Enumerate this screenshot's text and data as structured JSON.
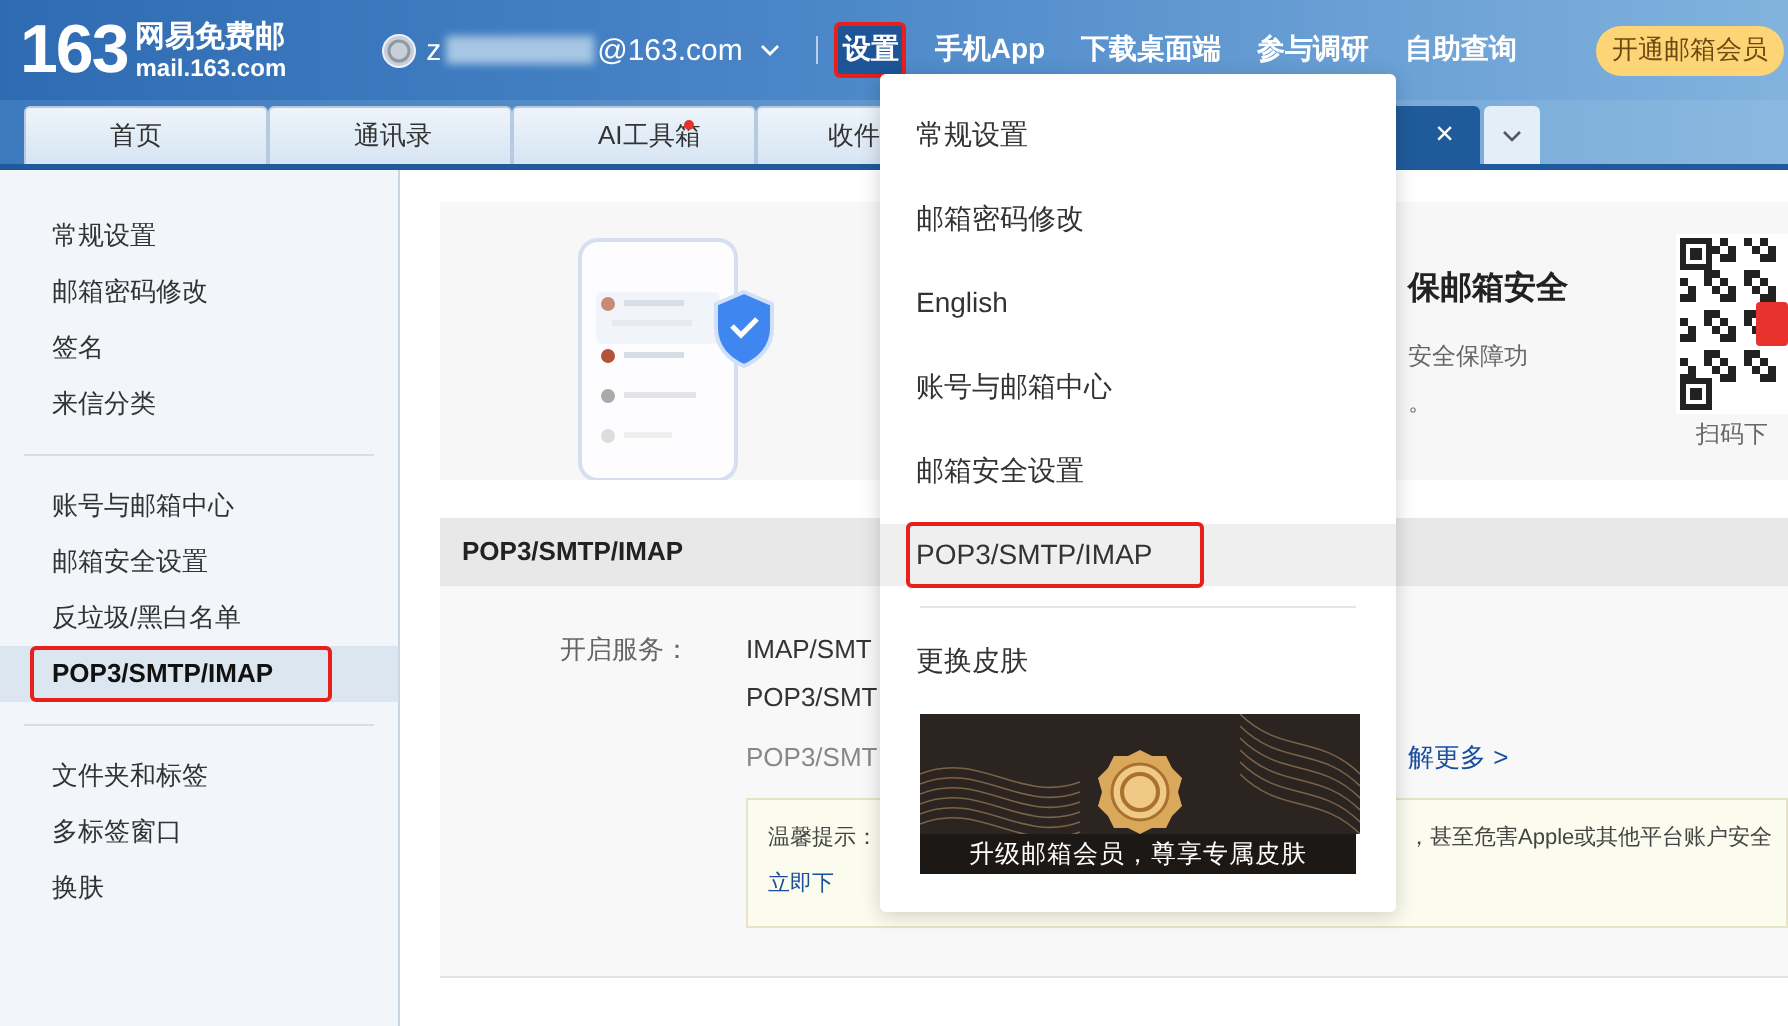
{
  "header": {
    "logo": {
      "number": "163",
      "brand": "网易免费邮",
      "domain": "mail.163.com"
    },
    "account": {
      "prefix": "z",
      "suffix": "@163.com"
    },
    "nav": [
      {
        "label": "设置",
        "selected": true,
        "annotated": true
      },
      {
        "label": "手机App",
        "selected": false,
        "annotated": false
      },
      {
        "label": "下载桌面端",
        "selected": false,
        "annotated": false
      },
      {
        "label": "参与调研",
        "selected": false,
        "annotated": false
      },
      {
        "label": "自助查询",
        "selected": false,
        "annotated": false
      }
    ],
    "vip_button": "开通邮箱会员"
  },
  "tabs": [
    {
      "label": "首页",
      "selected": false,
      "unread_dot": false
    },
    {
      "label": "通讯录",
      "selected": false,
      "unread_dot": false
    },
    {
      "label": "AI工具箱",
      "selected": false,
      "unread_dot": true
    },
    {
      "label": "收件",
      "selected": false,
      "unread_dot": false
    },
    {
      "selected": true,
      "unread_dot": false,
      "close": "×"
    }
  ],
  "sidebar": {
    "groups": [
      {
        "items": [
          {
            "label": "常规设置",
            "selected": false,
            "annotated": false
          },
          {
            "label": "邮箱密码修改",
            "selected": false,
            "annotated": false
          },
          {
            "label": "签名",
            "selected": false,
            "annotated": false
          },
          {
            "label": "来信分类",
            "selected": false,
            "annotated": false
          }
        ]
      },
      {
        "items": [
          {
            "label": "账号与邮箱中心",
            "selected": false,
            "annotated": false
          },
          {
            "label": "邮箱安全设置",
            "selected": false,
            "annotated": false
          },
          {
            "label": "反垃圾/黑白名单",
            "selected": false,
            "annotated": false
          },
          {
            "label": "POP3/SMTP/IMAP",
            "selected": true,
            "annotated": true
          }
        ]
      },
      {
        "items": [
          {
            "label": "文件夹和标签",
            "selected": false,
            "annotated": false
          },
          {
            "label": "多标签窗口",
            "selected": false,
            "annotated": false
          },
          {
            "label": "换肤",
            "selected": false,
            "annotated": false
          }
        ]
      }
    ]
  },
  "banner": {
    "title": "保邮箱安全",
    "description": [
      "安全保障功",
      "。"
    ],
    "qr_caption": "扫码下"
  },
  "section": {
    "title": "POP3/SMTP/IMAP",
    "service_label": "开启服务：",
    "services": [
      {
        "kind": "service",
        "text": "IMAP/SMT"
      },
      {
        "kind": "service",
        "text": "POP3/SMT"
      },
      {
        "kind": "note",
        "text": "POP3/SMT",
        "link": "解更多 >"
      }
    ],
    "notice": {
      "label": "温馨提示：",
      "text": "，甚至危害Apple或其他平台账户安全",
      "link": "立即下"
    }
  },
  "settings_menu": {
    "items": [
      {
        "label": "常规设置",
        "selected": false,
        "annotated": false
      },
      {
        "label": "邮箱密码修改",
        "selected": false,
        "annotated": false
      },
      {
        "label": "English",
        "selected": false,
        "annotated": false
      },
      {
        "label": "账号与邮箱中心",
        "selected": false,
        "annotated": false
      },
      {
        "label": "邮箱安全设置",
        "selected": false,
        "annotated": false
      },
      {
        "label": "POP3/SMTP/IMAP",
        "selected": true,
        "annotated": true
      }
    ],
    "skin_item": "更换皮肤",
    "promo_caption": "升级邮箱会员，尊享专属皮肤"
  }
}
